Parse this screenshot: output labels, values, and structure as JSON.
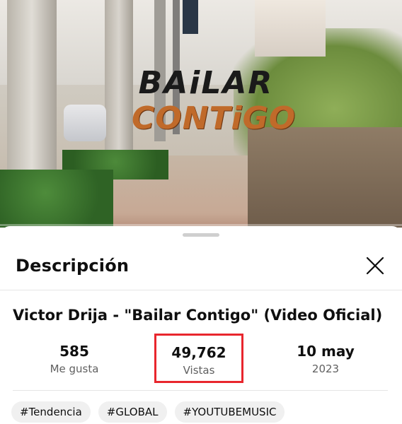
{
  "video": {
    "title_line1": "BAiLAR",
    "title_line2": "CONTiGO"
  },
  "sheet": {
    "title": "Descripción",
    "close_icon": "close-icon"
  },
  "description": {
    "video_title": "Victor Drija - \"Bailar Contigo\" (Video Oficial)",
    "stats": {
      "likes_value": "585",
      "likes_label": "Me gusta",
      "views_value": "49,762",
      "views_label": "Vistas",
      "date_value": "10 may",
      "date_year": "2023"
    },
    "highlight_color": "#e8262d",
    "tags": [
      "#Tendencia",
      "#GLOBAL",
      "#YOUTUBEMUSIC"
    ]
  },
  "colors": {
    "accent_red": "#ff0000",
    "text_primary": "#0f0f0f",
    "text_secondary": "#606060"
  }
}
